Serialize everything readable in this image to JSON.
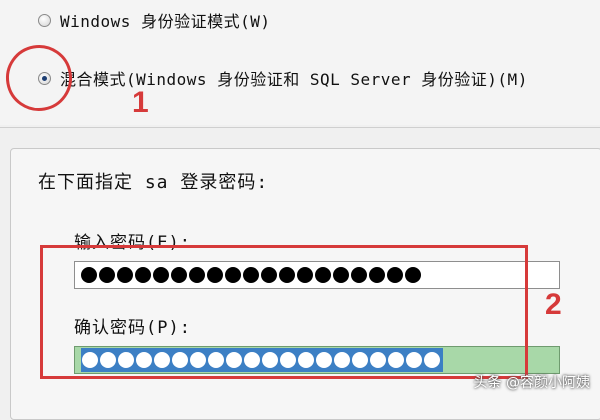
{
  "auth_mode": {
    "options": [
      {
        "label": "Windows 身份验证模式(W)",
        "checked": false
      },
      {
        "label": "混合模式(Windows 身份验证和 SQL Server 身份验证)(M)",
        "checked": true
      }
    ]
  },
  "sa_password": {
    "section_label": "在下面指定 sa 登录密码:",
    "password_label": "输入密码(E):",
    "password_mask_count": 19,
    "confirm_label": "确认密码(P):",
    "confirm_mask_count": 20
  },
  "annotations": {
    "step1": "1",
    "step2": "2",
    "color": "#d63a3a"
  },
  "watermark": "头条 @容颜小阿姨"
}
